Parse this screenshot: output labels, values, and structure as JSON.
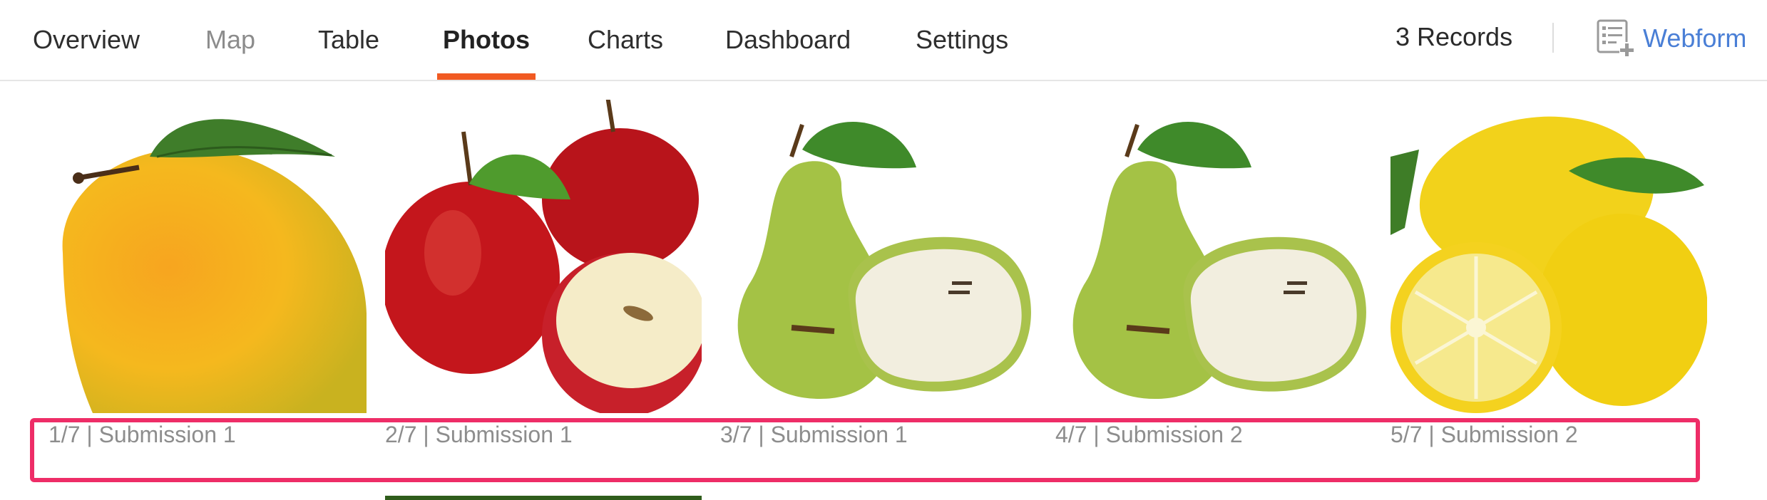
{
  "nav": {
    "tabs": [
      {
        "label": "Overview",
        "state": "normal"
      },
      {
        "label": "Map",
        "state": "disabled"
      },
      {
        "label": "Table",
        "state": "normal"
      },
      {
        "label": "Photos",
        "state": "active"
      },
      {
        "label": "Charts",
        "state": "normal"
      },
      {
        "label": "Dashboard",
        "state": "normal"
      },
      {
        "label": "Settings",
        "state": "normal"
      }
    ],
    "records_label": "3 Records",
    "webform_label": "Webform",
    "webform_icon": "webform-add-icon",
    "accent_color": "#f15a22",
    "link_color": "#4a7fd6"
  },
  "photos": [
    {
      "caption": "1/7 | Submission 1",
      "subject": "mango"
    },
    {
      "caption": "2/7 | Submission 1",
      "subject": "apples"
    },
    {
      "caption": "3/7 | Submission 1",
      "subject": "pears"
    },
    {
      "caption": "4/7 | Submission 2",
      "subject": "pears"
    },
    {
      "caption": "5/7 | Submission 2",
      "subject": "lemons"
    }
  ],
  "highlight_color": "#ee2d67"
}
